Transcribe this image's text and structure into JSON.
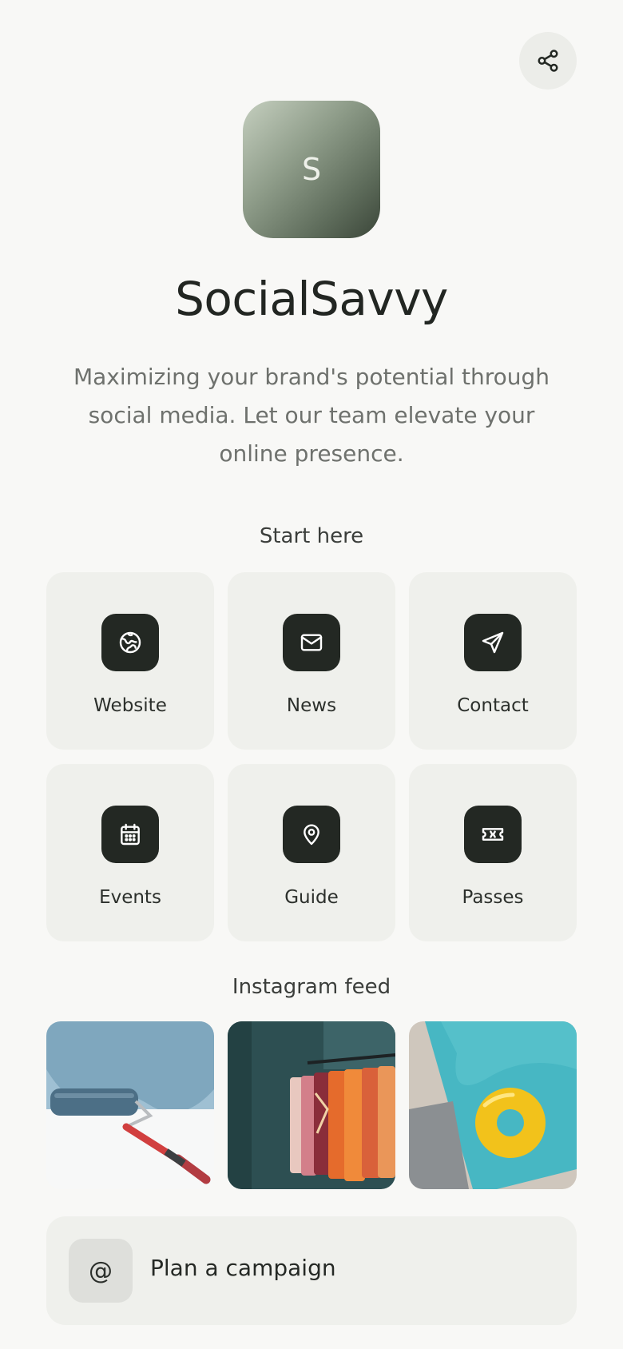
{
  "header": {
    "share_icon": "share-icon"
  },
  "profile": {
    "avatar_letter": "S",
    "name": "SocialSavvy",
    "bio": "Maximizing your brand's potential through social media. Let our team elevate your online presence."
  },
  "start_here": {
    "label": "Start here",
    "tiles": [
      {
        "label": "Website",
        "icon": "globe-icon"
      },
      {
        "label": "News",
        "icon": "mail-icon"
      },
      {
        "label": "Contact",
        "icon": "send-icon"
      },
      {
        "label": "Events",
        "icon": "calendar-icon"
      },
      {
        "label": "Guide",
        "icon": "map-pin-icon"
      },
      {
        "label": "Passes",
        "icon": "ticket-icon"
      }
    ]
  },
  "instagram": {
    "label": "Instagram feed",
    "photos": [
      "paint-roller-photo",
      "clothing-rack-photo",
      "pool-float-photo"
    ]
  },
  "campaign": {
    "icon_glyph": "@",
    "label": "Plan a campaign"
  },
  "colors": {
    "background": "#f8f8f6",
    "tile": "#eff0ec",
    "icon_bg": "#232823",
    "text": "#222622",
    "muted": "#6e716d"
  }
}
